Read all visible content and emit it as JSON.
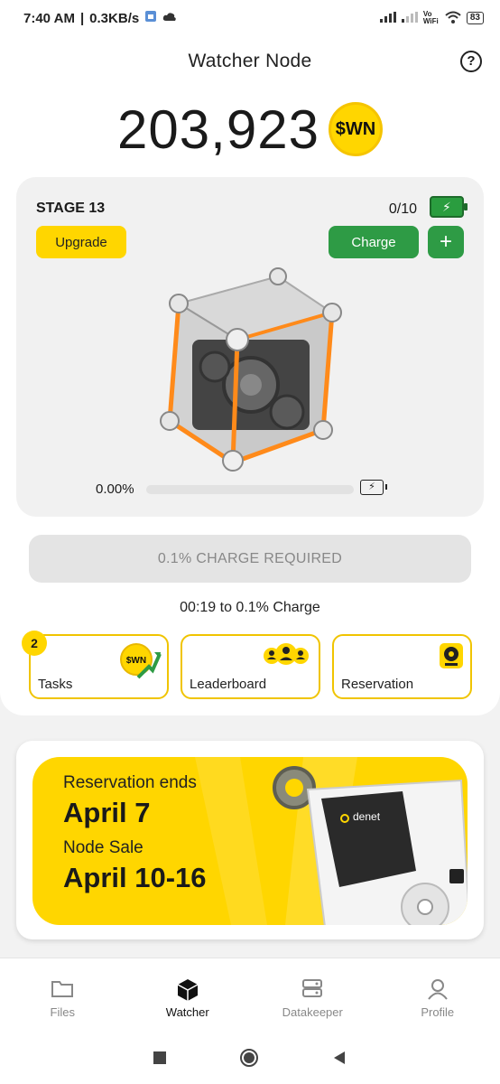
{
  "status_bar": {
    "time": "7:40 AM",
    "speed": "0.3KB/s",
    "network": "Vo WiFi",
    "battery": "83"
  },
  "header": {
    "title": "Watcher Node"
  },
  "balance": {
    "amount": "203,923",
    "token": "$WN"
  },
  "node": {
    "stage": "STAGE 13",
    "charges": "0/10",
    "upgrade_label": "Upgrade",
    "charge_label": "Charge",
    "plus_label": "+",
    "progress_text": "0.00%",
    "progress": 0.0
  },
  "charge_required": "0.1% CHARGE REQUIRED",
  "timer": "00:19 to 0.1% Charge",
  "tiles": [
    {
      "label": "Tasks",
      "badge": "2",
      "icon": "wn-coin-arrow-icon"
    },
    {
      "label": "Leaderboard",
      "icon": "people-icon"
    },
    {
      "label": "Reservation",
      "icon": "device-icon"
    }
  ],
  "banner": {
    "line1": "Reservation ends",
    "date1": "April 7",
    "line2": "Node Sale",
    "date2": "April 10-16",
    "device_brand": "denet"
  },
  "nav": [
    {
      "label": "Files",
      "icon": "folder-icon"
    },
    {
      "label": "Watcher",
      "icon": "cube-icon",
      "active": true
    },
    {
      "label": "Datakeeper",
      "icon": "server-icon"
    },
    {
      "label": "Profile",
      "icon": "user-icon"
    }
  ],
  "colors": {
    "accent_yellow": "#ffd600",
    "accent_green": "#2e9b45",
    "orange_glow": "#ff8a1a"
  }
}
